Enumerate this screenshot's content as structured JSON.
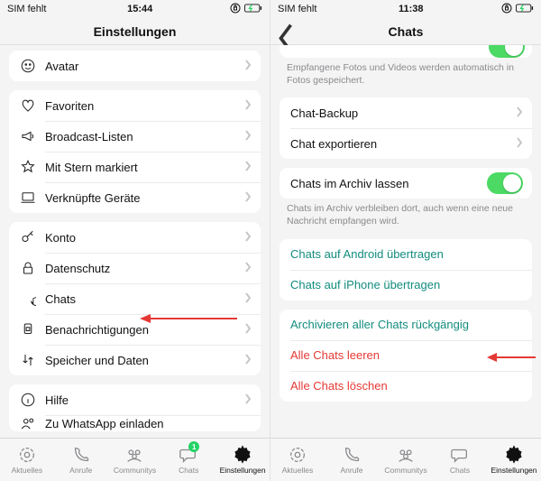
{
  "left": {
    "status": {
      "carrier": "SIM fehlt",
      "time": "15:44"
    },
    "title": "Einstellungen",
    "group1": {
      "avatar": "Avatar"
    },
    "group2": {
      "favoriten": "Favoriten",
      "broadcast": "Broadcast-Listen",
      "starred": "Mit Stern markiert",
      "devices": "Verknüpfte Geräte"
    },
    "group3": {
      "konto": "Konto",
      "datenschutz": "Datenschutz",
      "chats": "Chats",
      "benachrichtigungen": "Benachrichtigungen",
      "speicher": "Speicher und Daten"
    },
    "group4": {
      "hilfe": "Hilfe",
      "invite": "Zu WhatsApp einladen"
    },
    "tabs": {
      "aktuelles": "Aktuelles",
      "anrufe": "Anrufe",
      "communitys": "Communitys",
      "chats": "Chats",
      "chats_badge": "1",
      "einstellungen": "Einstellungen"
    }
  },
  "right": {
    "status": {
      "carrier": "SIM fehlt",
      "time": "11:38"
    },
    "title": "Chats",
    "media_footer": "Empfangene Fotos und Videos werden automatisch in Fotos gespeichert.",
    "group_backup": {
      "backup": "Chat-Backup",
      "export": "Chat exportieren"
    },
    "archive": {
      "label": "Chats im Archiv lassen",
      "footer": "Chats im Archiv verbleiben dort, auch wenn eine neue Nachricht empfangen wird."
    },
    "transfer": {
      "android": "Chats auf Android übertragen",
      "iphone": "Chats auf iPhone übertragen"
    },
    "danger": {
      "unarchive": "Archivieren aller Chats rückgängig",
      "clear": "Alle Chats leeren",
      "delete": "Alle Chats löschen"
    },
    "tabs": {
      "aktuelles": "Aktuelles",
      "anrufe": "Anrufe",
      "communitys": "Communitys",
      "chats": "Chats",
      "einstellungen": "Einstellungen"
    }
  }
}
